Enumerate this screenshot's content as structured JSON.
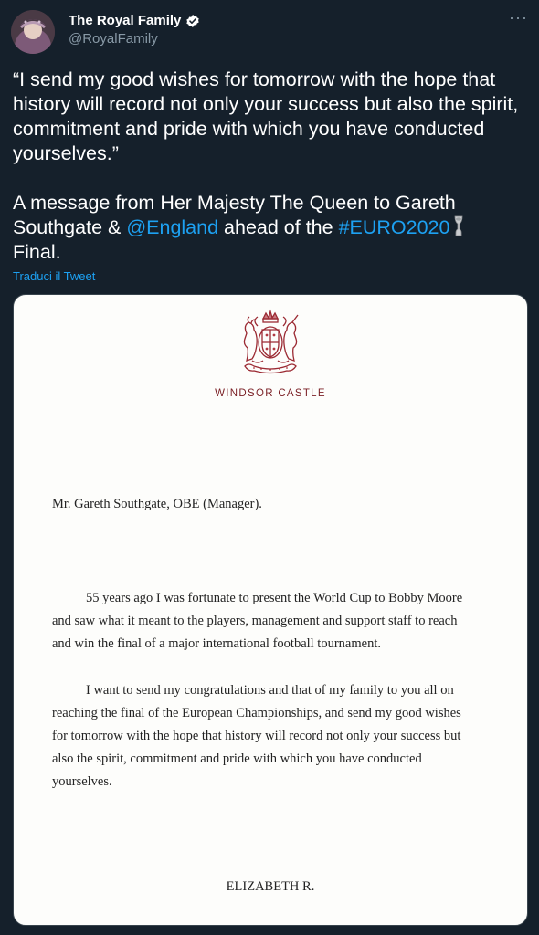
{
  "author": {
    "display_name": "The Royal Family",
    "handle": "@RoyalFamily",
    "verified_icon": "verified-badge-icon",
    "avatar_icon": "profile-avatar"
  },
  "menu_icon": "more-options-icon",
  "tweet": {
    "quote": "“I send my good wishes for tomorrow with the hope that history will record not only your success but also the spirit, commitment and pride with which you have conducted yourselves.”",
    "message_part1": "A message from Her Majesty The Queen to Gareth Southgate & ",
    "mention": "@England",
    "message_part2": " ahead of the ",
    "hashtag": "#EURO2020",
    "trophy_icon": "trophy-icon",
    "message_part3": "Final.",
    "translate_label": "Traduci il Tweet"
  },
  "letter": {
    "crest_icon": "royal-coat-of-arms-icon",
    "letterhead": "WINDSOR CASTLE",
    "salutation": "Mr. Gareth Southgate, OBE (Manager).",
    "paragraph1_lines": [
      "55 years ago I was fortunate to present the World Cup to Bobby Moore",
      "and saw what it meant to the players, management and support staff to reach",
      "and win the final of a major international football tournament."
    ],
    "paragraph2_lines": [
      "I want to send my congratulations and that of my family to you all on",
      "reaching the final of the European Championships, and send my good wishes",
      "for tomorrow with the hope that history will record not only your success but",
      "also the spirit, commitment and pride with which you have conducted",
      "yourselves."
    ],
    "signature": "ELIZABETH R."
  },
  "colors": {
    "background": "#15202b",
    "link": "#1da1f2",
    "secondary_text": "#8899a6",
    "letterhead_red": "#7a1f25"
  }
}
